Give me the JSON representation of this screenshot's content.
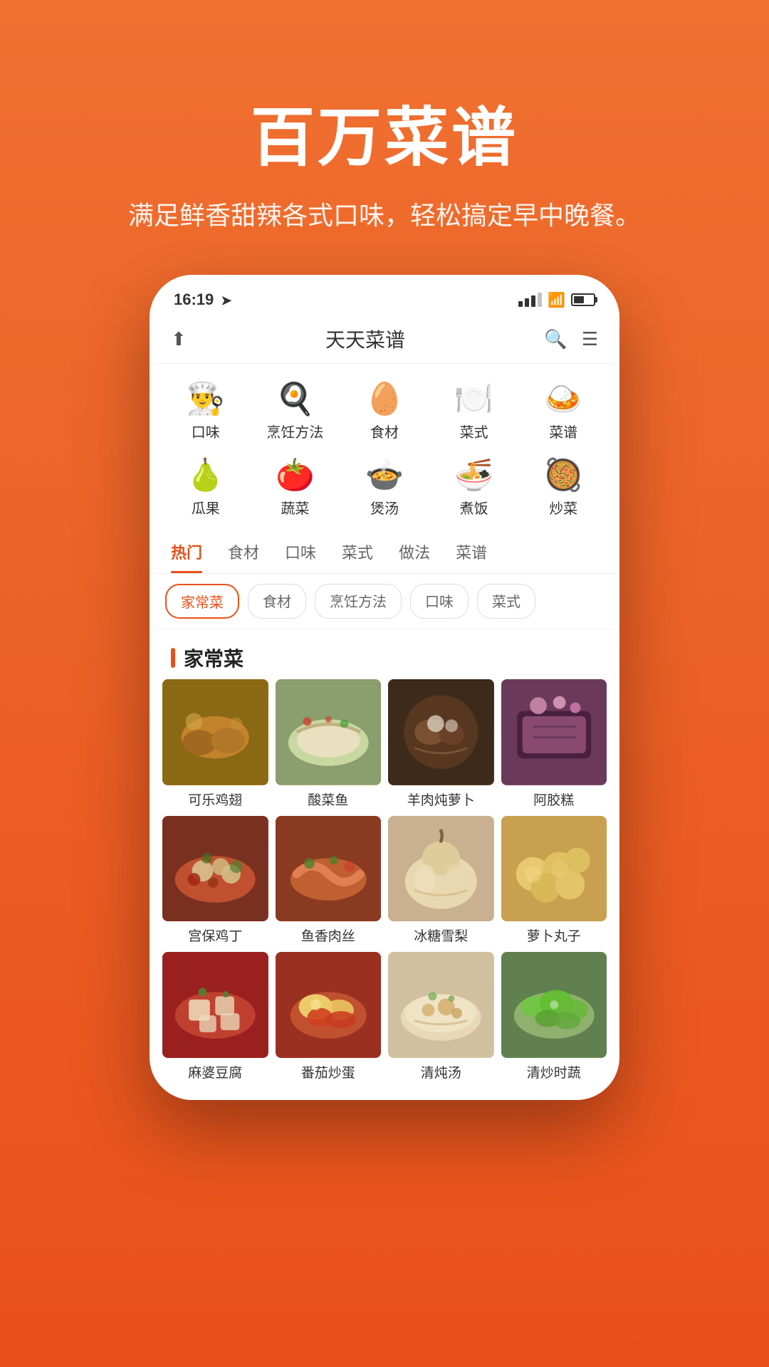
{
  "hero": {
    "title": "百万菜谱",
    "subtitle": "满足鲜香甜辣各式口味，轻松搞定早中晚餐。"
  },
  "statusBar": {
    "time": "16:19",
    "arrowIcon": "➤"
  },
  "appHeader": {
    "shareIcon": "⬆",
    "title": "天天菜谱",
    "searchIcon": "🔍",
    "menuIcon": "☰"
  },
  "categories": {
    "row1": [
      {
        "id": "taste",
        "icon": "👨‍🍳",
        "label": "口味"
      },
      {
        "id": "cooking-method",
        "icon": "🍳",
        "label": "烹饪方法"
      },
      {
        "id": "ingredients",
        "icon": "🥚",
        "label": "食材"
      },
      {
        "id": "dish-style",
        "icon": "🍽️",
        "label": "菜式"
      },
      {
        "id": "recipe",
        "icon": "🍛",
        "label": "菜谱"
      }
    ],
    "row2": [
      {
        "id": "fruit",
        "icon": "🍐",
        "label": "瓜果"
      },
      {
        "id": "vegetable",
        "icon": "🍅",
        "label": "蔬菜"
      },
      {
        "id": "soup",
        "icon": "🍲",
        "label": "煲汤"
      },
      {
        "id": "rice",
        "icon": "🍜",
        "label": "煮饭"
      },
      {
        "id": "stir-fry",
        "icon": "🥘",
        "label": "炒菜"
      }
    ]
  },
  "tabs": [
    {
      "id": "hot",
      "label": "热门",
      "active": true
    },
    {
      "id": "ingredients",
      "label": "食材",
      "active": false
    },
    {
      "id": "taste",
      "label": "口味",
      "active": false
    },
    {
      "id": "dish-style",
      "label": "菜式",
      "active": false
    },
    {
      "id": "method",
      "label": "做法",
      "active": false
    },
    {
      "id": "recipe",
      "label": "菜谱",
      "active": false
    }
  ],
  "filters": [
    {
      "id": "home-cooking",
      "label": "家常菜",
      "active": true
    },
    {
      "id": "ingredients",
      "label": "食材",
      "active": false
    },
    {
      "id": "cooking-method",
      "label": "烹饪方法",
      "active": false
    },
    {
      "id": "taste",
      "label": "口味",
      "active": false
    },
    {
      "id": "dish-style",
      "label": "菜式",
      "active": false
    }
  ],
  "sectionTitle": "家常菜",
  "foodItems": [
    {
      "id": "cola-chicken",
      "name": "可乐鸡翅",
      "colorClass": "fp-chicken"
    },
    {
      "id": "sauerkraut-fish",
      "name": "酸菜鱼",
      "colorClass": "fp-fish"
    },
    {
      "id": "lamb-radish",
      "name": "羊肉炖萝卜",
      "colorClass": "fp-lamb"
    },
    {
      "id": "ejiao-cake",
      "name": "阿胶糕",
      "colorClass": "fp-cake"
    },
    {
      "id": "kungpao-chicken",
      "name": "宫保鸡丁",
      "colorClass": "fp-kungpao"
    },
    {
      "id": "fish-pork",
      "name": "鱼香肉丝",
      "colorClass": "fp-yuxiang"
    },
    {
      "id": "rock-sugar-pear",
      "name": "冰糖雪梨",
      "colorClass": "fp-pear"
    },
    {
      "id": "radish-balls",
      "name": "萝卜丸子",
      "colorClass": "fp-radish"
    },
    {
      "id": "mapo-tofu",
      "name": "麻婆豆腐",
      "colorClass": "fp-mapo"
    },
    {
      "id": "tomato-egg",
      "name": "番茄炒蛋",
      "colorClass": "fp-tomato"
    },
    {
      "id": "clear-soup",
      "name": "清炖汤",
      "colorClass": "fp-soup"
    },
    {
      "id": "green-veg",
      "name": "清炒时蔬",
      "colorClass": "fp-greens"
    }
  ]
}
